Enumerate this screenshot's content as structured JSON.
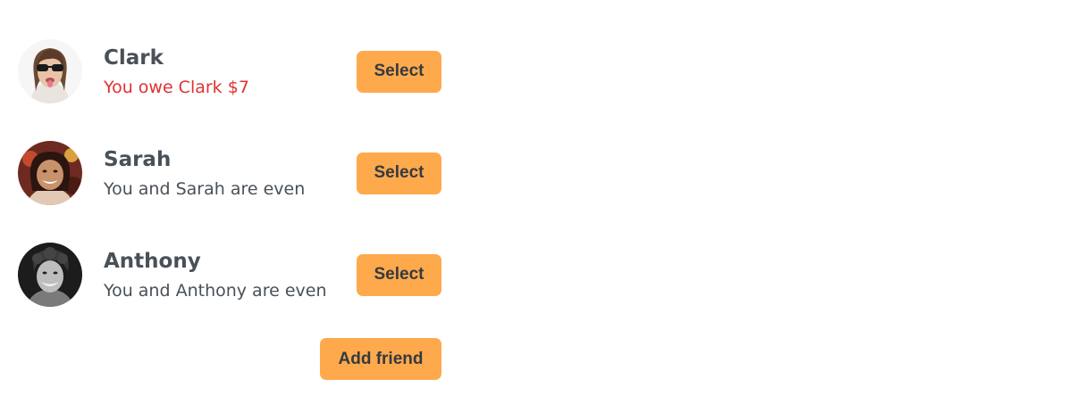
{
  "friends": [
    {
      "name": "Clark",
      "status": "You owe Clark $7",
      "status_color": "#e03131",
      "select_label": "Select",
      "avatar_icon": "clark-avatar"
    },
    {
      "name": "Sarah",
      "status": "You and Sarah are even",
      "status_color": "#495057",
      "select_label": "Select",
      "avatar_icon": "sarah-avatar"
    },
    {
      "name": "Anthony",
      "status": "You and Anthony are even",
      "status_color": "#495057",
      "select_label": "Select",
      "avatar_icon": "anthony-avatar"
    }
  ],
  "actions": {
    "add_friend_label": "Add friend"
  },
  "colors": {
    "accent": "#ffa94d",
    "owe": "#e03131",
    "text": "#495057"
  }
}
